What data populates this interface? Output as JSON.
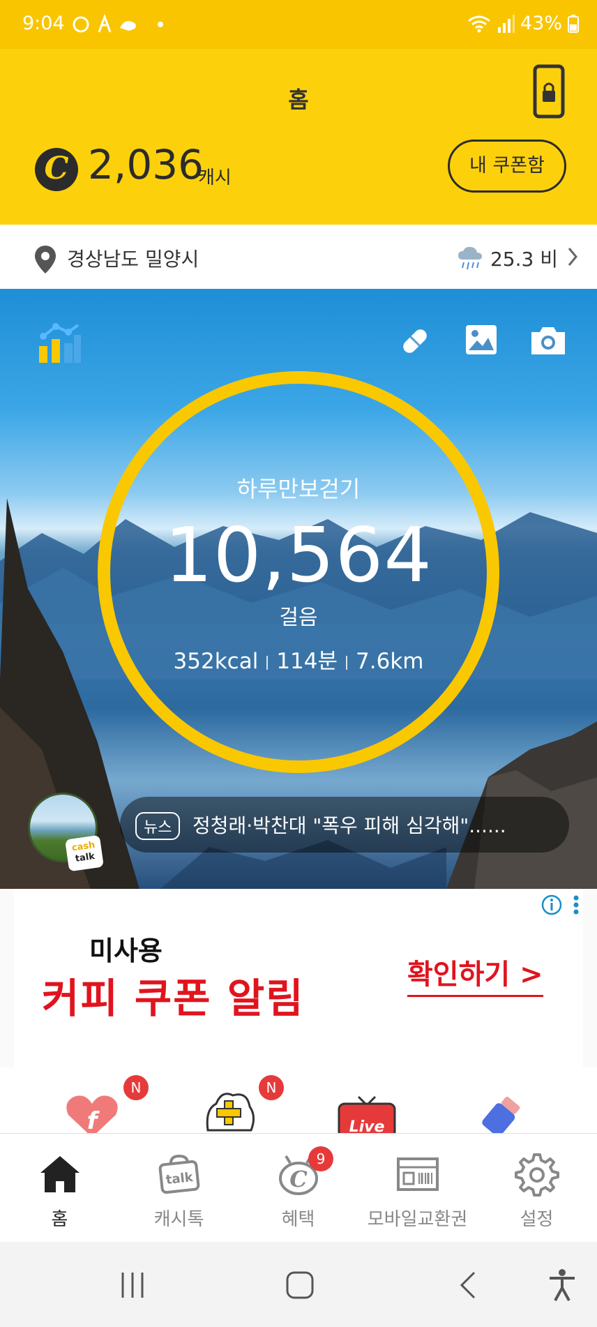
{
  "status_bar": {
    "time": "9:04",
    "battery": "43%"
  },
  "header": {
    "title": "홈",
    "cash_amount": "2,036",
    "cash_unit": "캐시",
    "coupon_button": "내 쿠폰함",
    "coin_symbol": "C"
  },
  "location_bar": {
    "location": "경상남도 밀양시",
    "weather": "25.3 비"
  },
  "pedometer": {
    "label": "하루만보걷기",
    "steps": "10,564",
    "steps_unit": "걸음",
    "calories": "352kcal",
    "minutes": "114분",
    "distance": "7.6km"
  },
  "news": {
    "tag": "뉴스",
    "headline": "정청래·박찬대 \"폭우 피해 심각해\"......",
    "badge_top": "cash",
    "badge_bottom": "talk"
  },
  "ad": {
    "subtitle": "미사용",
    "title": "커피 쿠폰 알림",
    "cta": "확인하기 >"
  },
  "shortcuts": {
    "new_badge": "N",
    "live_label": "Live"
  },
  "bottom_nav": {
    "items": [
      {
        "label": "홈"
      },
      {
        "label": "캐시톡"
      },
      {
        "label": "혜택",
        "badge": "9"
      },
      {
        "label": "모바일교환권"
      },
      {
        "label": "설정"
      }
    ]
  },
  "colors": {
    "brand_yellow": "#fcd10c",
    "ad_red": "#e0141e",
    "badge_red": "#e63a3a"
  }
}
